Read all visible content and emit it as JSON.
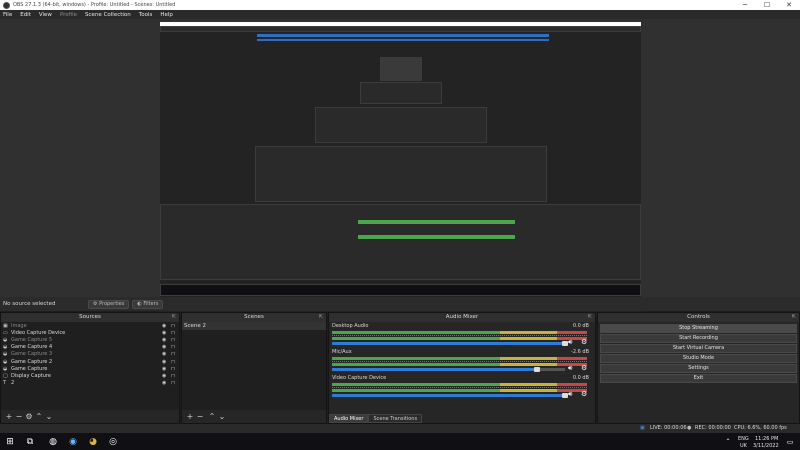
{
  "window": {
    "title": "OBS 27.1.3 (64-bit, windows) - Profile: Untitled - Scenes: Untitled",
    "minimize": "─",
    "maximize": "☐",
    "close": "✕"
  },
  "menu": [
    "File",
    "Edit",
    "View",
    "Profile",
    "Scene Collection",
    "Tools",
    "Help"
  ],
  "context_bar": {
    "no_source": "No source selected",
    "properties": "Properties",
    "filters": "Filters"
  },
  "sources": {
    "title": "Sources",
    "items": [
      {
        "name": "Image",
        "icon": "image-icon",
        "enabled": false
      },
      {
        "name": "Video Capture Device",
        "icon": "camera-icon",
        "enabled": true
      },
      {
        "name": "Game Capture 5",
        "icon": "gamepad-icon",
        "enabled": false
      },
      {
        "name": "Game Capture 4",
        "icon": "gamepad-icon",
        "enabled": true
      },
      {
        "name": "Game Capture 3",
        "icon": "gamepad-icon",
        "enabled": false
      },
      {
        "name": "Game Capture 2",
        "icon": "gamepad-icon",
        "enabled": true
      },
      {
        "name": "Game Capture",
        "icon": "gamepad-icon",
        "enabled": true
      },
      {
        "name": "Display Capture",
        "icon": "monitor-icon",
        "enabled": true
      },
      {
        "name": "2",
        "icon": "text-icon",
        "enabled": true
      }
    ]
  },
  "scenes": {
    "title": "Scenes",
    "items": [
      "Scene 2"
    ]
  },
  "audio_mixer": {
    "title": "Audio Mixer",
    "channels": [
      {
        "name": "Desktop Audio",
        "db": "0.0 dB",
        "level": 1.0
      },
      {
        "name": "Mic/Aux",
        "db": "-2.6 dB",
        "level": 0.88
      },
      {
        "name": "Video Capture Device",
        "db": "0.0 dB",
        "level": 1.0
      }
    ],
    "tabs": [
      "Audio Mixer",
      "Scene Transitions"
    ]
  },
  "controls": {
    "title": "Controls",
    "buttons": [
      "Stop Streaming",
      "Start Recording",
      "Start Virtual Camera",
      "Studio Mode",
      "Settings",
      "Exit"
    ]
  },
  "status": {
    "live": "LIVE: 00:00:06",
    "rec": "REC: 00:00:00",
    "cpu": "CPU: 6.6%, 60.00 fps"
  },
  "taskbar": {
    "lang": "ENG",
    "region": "UK",
    "time": "11:26 PM",
    "date": "3/11/2022"
  },
  "colors": {
    "meter_green": "#4ca64c",
    "meter_yellow": "#c7b33a",
    "meter_red": "#c84646",
    "fader_blue": "#2d7cd6"
  }
}
